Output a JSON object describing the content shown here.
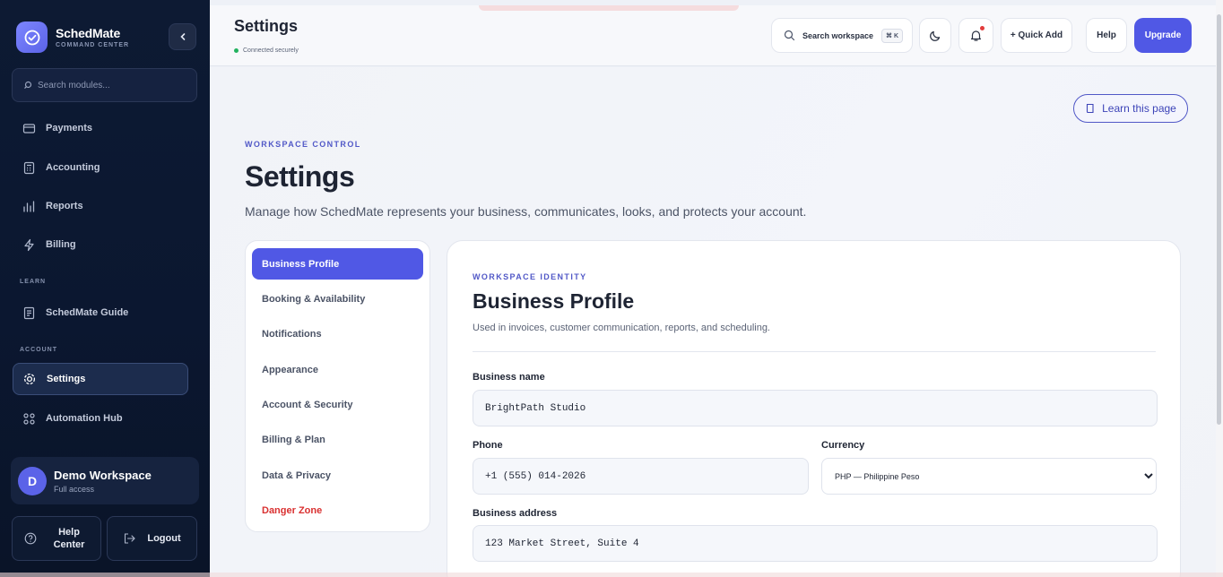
{
  "brand": {
    "name": "SchedMate",
    "subtitle": "COMMAND CENTER"
  },
  "sidebar": {
    "search_placeholder": "Search modules...",
    "items": [
      {
        "label": "Payments",
        "icon": "payments-icon"
      },
      {
        "label": "Accounting",
        "icon": "accounting-icon"
      },
      {
        "label": "Reports",
        "icon": "reports-icon"
      },
      {
        "label": "Billing",
        "icon": "billing-icon"
      }
    ],
    "learn_section": "LEARN",
    "learn_items": [
      {
        "label": "SchedMate Guide",
        "icon": "guide-icon"
      }
    ],
    "account_section": "ACCOUNT",
    "account_items": [
      {
        "label": "Settings",
        "icon": "settings-icon",
        "active": true
      },
      {
        "label": "Automation Hub",
        "icon": "automation-icon"
      }
    ],
    "workspace": {
      "initial": "D",
      "name": "Demo Workspace",
      "access": "Full access"
    },
    "help_label": "Help Center",
    "logout_label": "Logout"
  },
  "topbar": {
    "title": "Settings",
    "status": "Connected securely",
    "search_label": "Search workspace",
    "search_shortcut": "⌘ K",
    "quick_add": "+ Quick Add",
    "help": "Help",
    "upgrade": "Upgrade"
  },
  "main": {
    "learn_button": "Learn this page",
    "eyebrow": "WORKSPACE CONTROL",
    "title": "Settings",
    "description": "Manage how SchedMate represents your business, communicates, looks, and protects your account."
  },
  "settings_nav": [
    {
      "label": "Business Profile",
      "active": true
    },
    {
      "label": "Booking & Availability"
    },
    {
      "label": "Notifications"
    },
    {
      "label": "Appearance"
    },
    {
      "label": "Account & Security"
    },
    {
      "label": "Billing & Plan"
    },
    {
      "label": "Data & Privacy"
    },
    {
      "label": "Danger Zone",
      "danger": true
    }
  ],
  "profile": {
    "eyebrow": "WORKSPACE IDENTITY",
    "title": "Business Profile",
    "description": "Used in invoices, customer communication, reports, and scheduling.",
    "business_name_label": "Business name",
    "business_name_value": "BrightPath Studio",
    "phone_label": "Phone",
    "phone_value": "+1 (555) 014-2026",
    "currency_label": "Currency",
    "currency_value": "PHP — Philippine Peso",
    "address_label": "Business address",
    "address_value": "123 Market Street, Suite 4"
  },
  "colors": {
    "accent": "#5058e5",
    "sidebar": "#0d1a33",
    "danger": "#d93030",
    "online": "#22b25f"
  }
}
